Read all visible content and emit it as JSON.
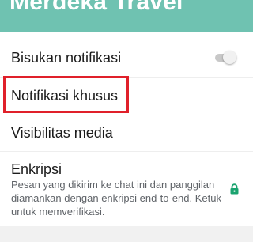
{
  "header": {
    "title": "Merdeka Travel",
    "color": "#6fc2b1"
  },
  "settings": {
    "mute_notifications": {
      "label": "Bisukan notifikasi",
      "enabled": false
    },
    "custom_notifications": {
      "label": "Notifikasi khusus"
    },
    "media_visibility": {
      "label": "Visibilitas media"
    },
    "encryption": {
      "label": "Enkripsi",
      "description": "Pesan yang dikirim ke chat ini dan panggilan diamankan dengan enkripsi end-to-end. Ketuk untuk memverifikasi.",
      "icon": "lock-icon",
      "icon_color": "#1aa36f"
    }
  },
  "highlight_color": "#e0202a"
}
